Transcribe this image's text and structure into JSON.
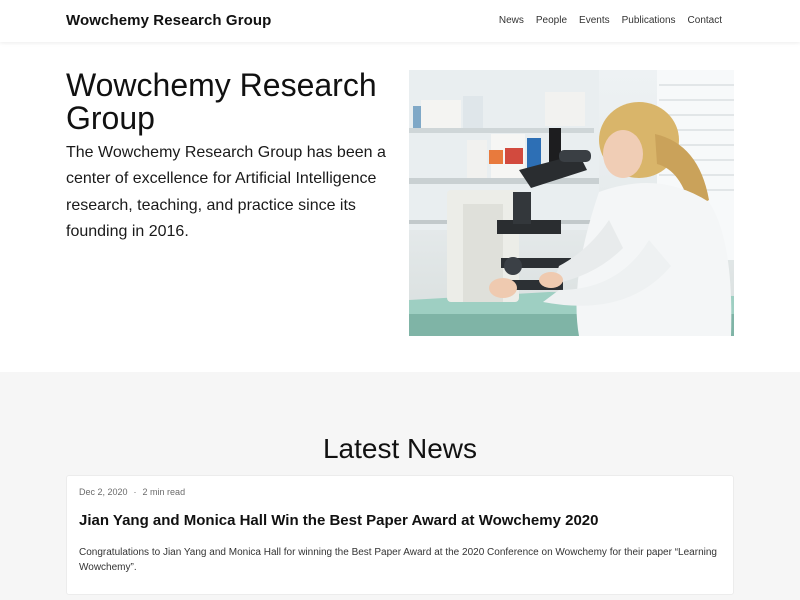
{
  "navbar": {
    "brand": "Wowchemy Research Group",
    "links": [
      "News",
      "People",
      "Events",
      "Publications",
      "Contact"
    ]
  },
  "hero": {
    "title": "Wowchemy Research Group",
    "description": "The Wowchemy Research Group has been a center of excellence for Artificial Intelligence research, teaching, and practice since its founding in 2016."
  },
  "news": {
    "heading": "Latest News",
    "posts": [
      {
        "date": "Dec 2, 2020",
        "separator": "·",
        "reading_time": "2 min read",
        "title": "Jian Yang and Monica Hall Win the Best Paper Award at Wowchemy 2020",
        "summary": "Congratulations to Jian Yang and Monica Hall for winning the Best Paper Award at the 2020 Conference on Wowchemy for their paper “Learning Wowchemy”."
      }
    ]
  }
}
